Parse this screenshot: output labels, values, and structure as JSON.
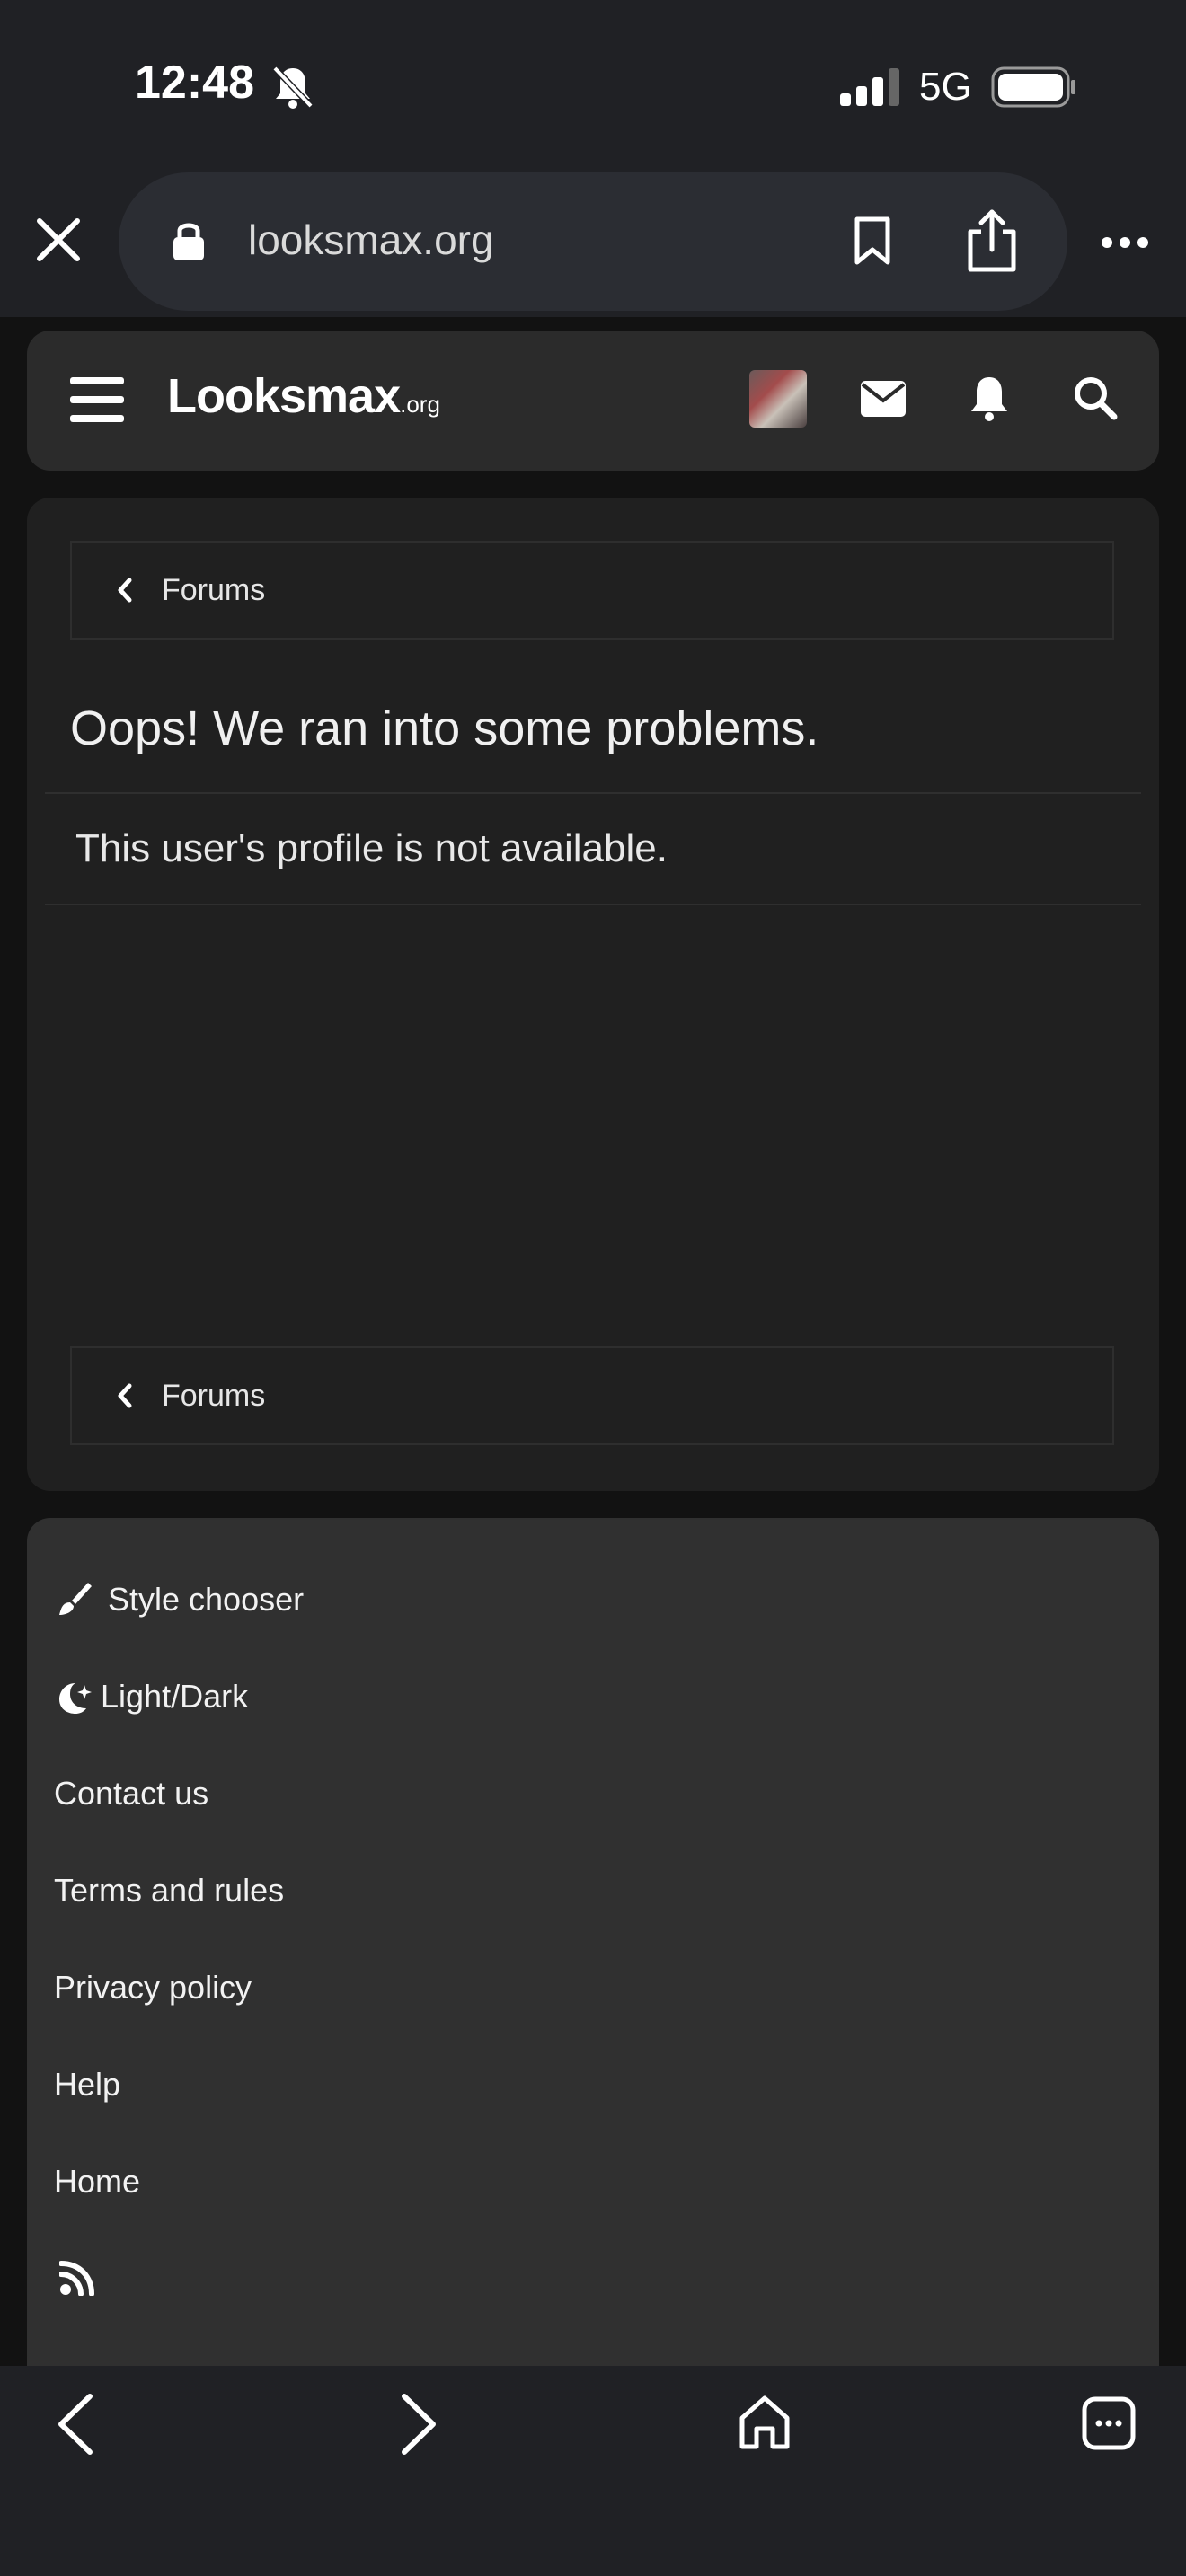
{
  "status_bar": {
    "time": "12:48",
    "network": "5G"
  },
  "browser": {
    "url": "looksmax.org"
  },
  "site": {
    "logo_main": "Looksmax",
    "logo_suffix": ".org"
  },
  "breadcrumb": {
    "label": "Forums"
  },
  "error": {
    "title": "Oops! We ran into some problems.",
    "message": "This user's profile is not available."
  },
  "footer": {
    "style_chooser": "Style chooser",
    "light_dark": "Light/Dark",
    "contact": "Contact us",
    "terms": "Terms and rules",
    "privacy": "Privacy policy",
    "help": "Help",
    "home": "Home"
  },
  "icons": [
    "bell-off-icon",
    "signal-icon",
    "battery-icon",
    "close-icon",
    "lock-icon",
    "bookmark-icon",
    "share-icon",
    "more-icon",
    "menu-icon",
    "mail-icon",
    "bell-icon",
    "search-icon",
    "chevron-left-icon",
    "brush-icon",
    "moon-icon",
    "rss-icon",
    "back-icon",
    "forward-icon",
    "home-icon",
    "tabs-icon"
  ]
}
